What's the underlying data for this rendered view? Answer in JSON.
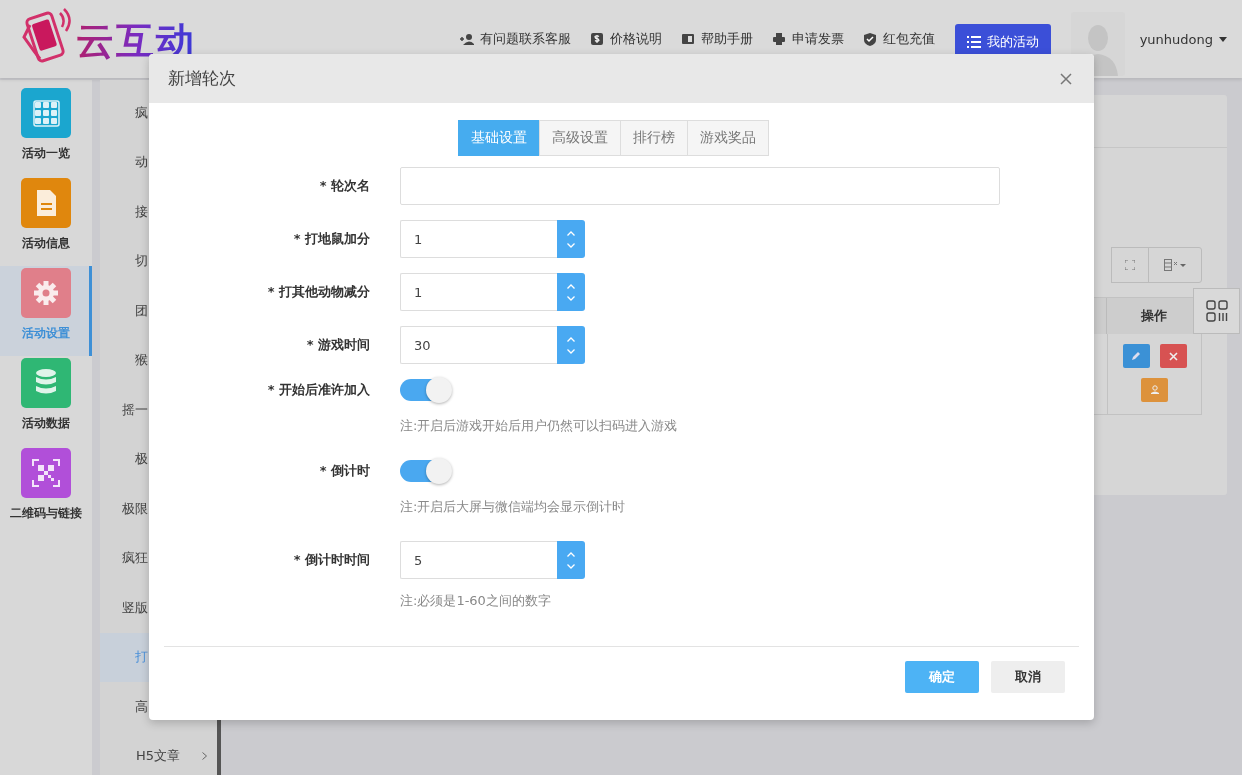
{
  "header": {
    "logo": "云互动",
    "nav": [
      {
        "label": "有问题联系客服"
      },
      {
        "label": "价格说明"
      },
      {
        "label": "帮助手册"
      },
      {
        "label": "申请发票"
      },
      {
        "label": "红包充值"
      }
    ],
    "primary_button": "我的活动",
    "user": "yunhudong"
  },
  "sidebar": {
    "items": [
      {
        "label": "活动一览",
        "color": "#1ba6cf",
        "selected": false
      },
      {
        "label": "活动信息",
        "color": "#e0870d",
        "selected": false
      },
      {
        "label": "活动设置",
        "color": "#e07f8a",
        "selected": true
      },
      {
        "label": "活动数据",
        "color": "#2fb774",
        "selected": false
      },
      {
        "label": "二维码与链接",
        "color": "#b14fd9",
        "selected": false
      }
    ]
  },
  "subnav": {
    "items": [
      {
        "label": "疯",
        "selected": false,
        "expandable": false
      },
      {
        "label": "动",
        "selected": false,
        "expandable": false
      },
      {
        "label": "接",
        "selected": false,
        "expandable": false
      },
      {
        "label": "切",
        "selected": false,
        "expandable": false
      },
      {
        "label": "团",
        "selected": false,
        "expandable": false
      },
      {
        "label": "猴",
        "selected": false,
        "expandable": false
      },
      {
        "label": "摇一",
        "selected": false,
        "expandable": false
      },
      {
        "label": "极",
        "selected": false,
        "expandable": false
      },
      {
        "label": "极限",
        "selected": false,
        "expandable": false
      },
      {
        "label": "疯狂",
        "selected": false,
        "expandable": false
      },
      {
        "label": "竖版",
        "selected": false,
        "expandable": false
      },
      {
        "label": "打",
        "selected": true,
        "expandable": false
      },
      {
        "label": "高",
        "selected": false,
        "expandable": false
      },
      {
        "label": "H5文章",
        "selected": false,
        "expandable": true
      }
    ]
  },
  "table": {
    "columns": [
      "操作"
    ]
  },
  "dialog": {
    "title": "新增轮次",
    "tabs": [
      {
        "label": "基础设置",
        "selected": true
      },
      {
        "label": "高级设置",
        "selected": false
      },
      {
        "label": "排行榜",
        "selected": false
      },
      {
        "label": "游戏奖品",
        "selected": false
      }
    ],
    "fields": [
      {
        "kind": "text",
        "label": "* 轮次名"
      },
      {
        "kind": "spinner",
        "label": "* 打地鼠加分",
        "value": "1"
      },
      {
        "kind": "spinner",
        "label": "* 打其他动物减分",
        "value": "1"
      },
      {
        "kind": "spinner",
        "label": "* 游戏时间",
        "value": "30"
      },
      {
        "kind": "toggle",
        "label": "* 开始后准许加入",
        "on": true,
        "note": "注:开启后游戏开始后用户仍然可以扫码进入游戏"
      },
      {
        "kind": "toggle",
        "label": "* 倒计时",
        "on": true,
        "note": "注:开启后大屏与微信端均会显示倒计时"
      },
      {
        "kind": "spinner",
        "label": "* 倒计时时间",
        "value": "5",
        "note": "注:必须是1-60之间的数字"
      }
    ],
    "buttons": [
      {
        "label": "确定",
        "kind": "primary"
      },
      {
        "label": "取消",
        "kind": "default"
      }
    ]
  }
}
